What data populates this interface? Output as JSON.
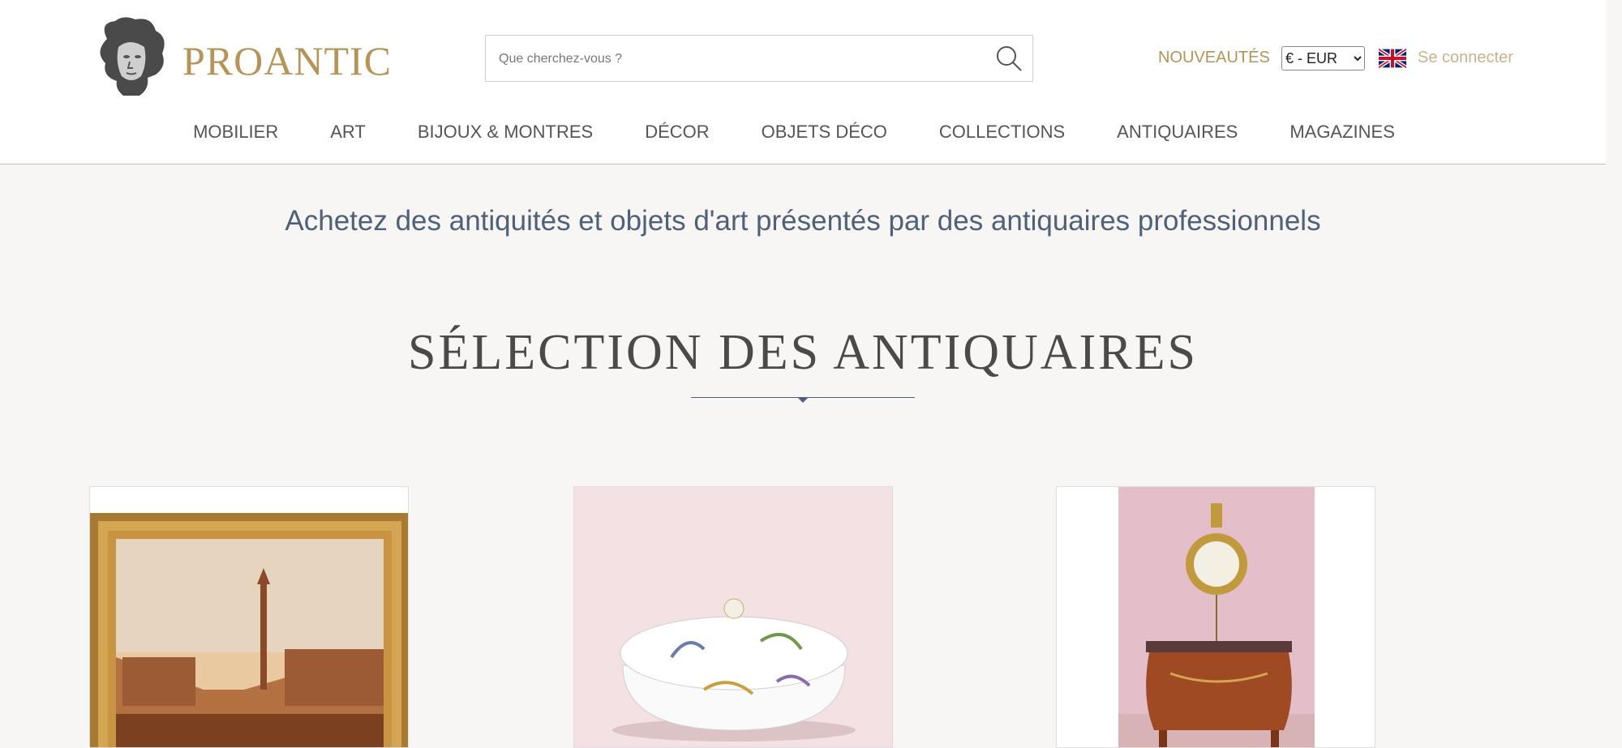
{
  "brand": {
    "logo_text": "PROANTIC"
  },
  "search": {
    "placeholder": "Que cherchez-vous ?"
  },
  "header_links": {
    "news": "NOUVEAUTÉS",
    "login": "Se connecter"
  },
  "currency": {
    "selected": "€ - EUR"
  },
  "nav": {
    "items": [
      "MOBILIER",
      "ART",
      "BIJOUX & MONTRES",
      "DÉCOR",
      "OBJETS DÉCO",
      "COLLECTIONS",
      "ANTIQUAIRES",
      "MAGAZINES"
    ]
  },
  "tagline": "Achetez des antiquités et objets d'art présentés par des antiquaires professionnels",
  "section": {
    "title": "SÉLECTION DES ANTIQUAIRES"
  },
  "products": [
    {
      "image": "venice-painting-icon"
    },
    {
      "image": "faience-tureen-icon"
    },
    {
      "image": "barometer-commode-icon"
    }
  ],
  "colors": {
    "brand_gold": "#b69356",
    "title_blue": "#4f6178",
    "background": "#f7f6f4"
  }
}
